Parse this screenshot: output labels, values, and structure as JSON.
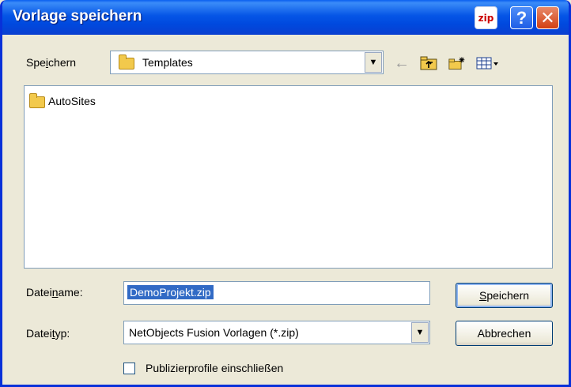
{
  "window": {
    "title": "Vorlage speichern",
    "zip_badge": "zip",
    "help_glyph": "?",
    "close_glyph": "✕",
    "colors": {
      "titlebar": "#0555e6",
      "face": "#ece9d8",
      "selection": "#316ac5"
    }
  },
  "lookin": {
    "label_pre": "Spe",
    "label_key": "i",
    "label_post": "chern",
    "value": "Templates",
    "dropdown_glyph": "▼"
  },
  "toolbar": {
    "back_icon": "←",
    "up_icon": "⮤",
    "new_folder_icon": "✱",
    "view_icon": "▦▾"
  },
  "files": [
    {
      "name": "AutoSites",
      "icon": "folder-icon"
    }
  ],
  "filename": {
    "label_pre": "Datei",
    "label_key": "n",
    "label_post": "ame:",
    "value": "DemoProjekt.zip"
  },
  "filetype": {
    "label_pre": "Datei",
    "label_key": "t",
    "label_post": "yp:",
    "value": "NetObjects Fusion Vorlagen (*.zip)",
    "dropdown_glyph": "▼"
  },
  "buttons": {
    "save_key": "S",
    "save_rest": "peichern",
    "cancel": "Abbrechen"
  },
  "options": {
    "include_profiles_label": "Publizierprofile einschließen",
    "include_profiles_checked": false
  }
}
